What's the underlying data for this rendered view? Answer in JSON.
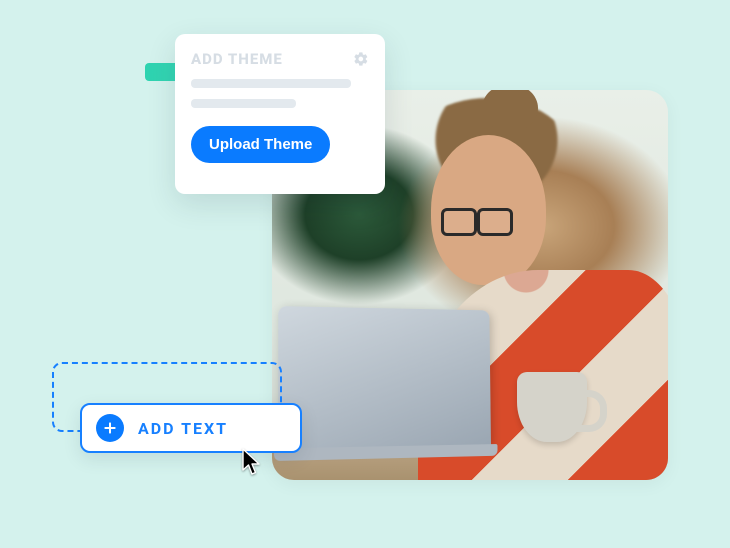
{
  "theme_card": {
    "title": "ADD THEME",
    "upload_button": "Upload Theme"
  },
  "add_text_button": {
    "label": "ADD TEXT"
  },
  "icons": {
    "gear": "gear-icon",
    "plus": "plus-icon",
    "cursor": "cursor-icon"
  },
  "colors": {
    "accent_blue": "#0a7bff",
    "accent_border": "#1780ff",
    "bg": "#d4f2ed"
  }
}
